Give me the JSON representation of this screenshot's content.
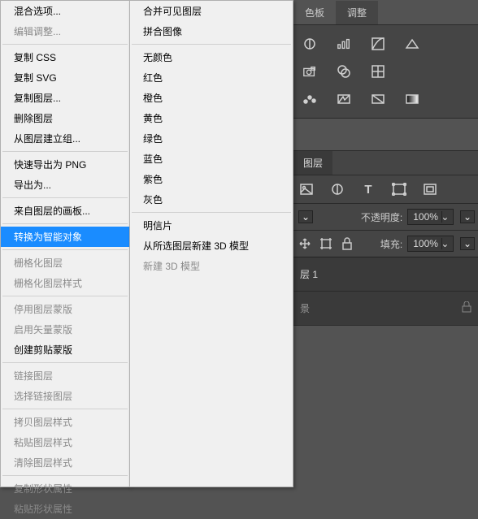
{
  "top_tabs": {
    "swatches": "色板",
    "adjustments": "调整"
  },
  "layers_tab": "图层",
  "opacity_label": "不透明度:",
  "opacity_value": "100%",
  "fill_label": "填充:",
  "fill_value": "100%",
  "layer1_name": "层 1",
  "bg_name": "景",
  "menu_left": {
    "blending_options": "混合选项...",
    "edit_adjustment": "编辑调整...",
    "copy_css": "复制 CSS",
    "copy_svg": "复制 SVG",
    "duplicate_layer": "复制图层...",
    "delete_layer": "删除图层",
    "group_from_layers": "从图层建立组...",
    "quick_export_png": "快速导出为 PNG",
    "export_as": "导出为...",
    "artboard_from_layers": "来自图层的画板...",
    "convert_smart": "转换为智能对象",
    "rasterize_layer": "栅格化图层",
    "rasterize_layer_style": "栅格化图层样式",
    "disable_layer_mask": "停用图层蒙版",
    "enable_vector_mask": "启用矢量蒙版",
    "create_clipping_mask": "创建剪贴蒙版",
    "link_layers": "链接图层",
    "select_linked": "选择链接图层",
    "copy_layer_style": "拷贝图层样式",
    "paste_layer_style": "粘贴图层样式",
    "clear_layer_style": "清除图层样式",
    "copy_shape_attrs": "复制形状属性",
    "paste_shape_attrs": "粘贴形状属性"
  },
  "menu_right": {
    "merge_visible": "合并可见图层",
    "flatten": "拼合图像",
    "no_color": "无颜色",
    "red": "红色",
    "orange": "橙色",
    "yellow": "黄色",
    "green": "绿色",
    "blue": "蓝色",
    "purple": "紫色",
    "gray": "灰色",
    "postcard": "明信片",
    "new_3d_from_sel": "从所选图层新建 3D 模型",
    "new_3d": "新建 3D 模型"
  }
}
